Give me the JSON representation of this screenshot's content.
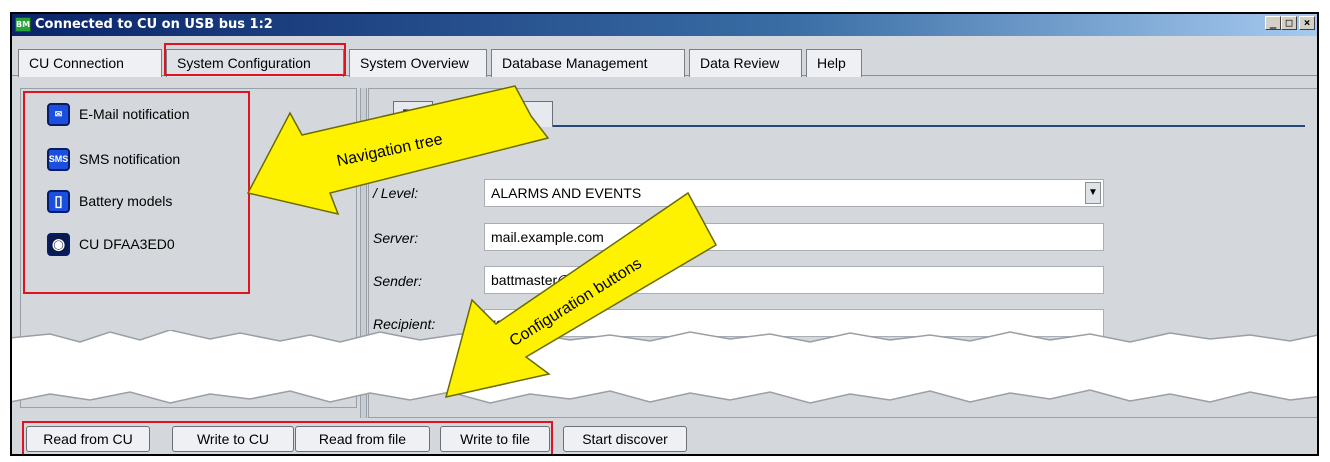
{
  "window": {
    "title": "Connected to CU on USB bus 1:2",
    "app_icon": "BM",
    "controls": [
      "_",
      "□",
      "×"
    ]
  },
  "tabs": [
    {
      "label": "CU Connection"
    },
    {
      "label": "System Configuration",
      "active": true
    },
    {
      "label": "System Overview"
    },
    {
      "label": "Database Management"
    },
    {
      "label": "Data Review"
    },
    {
      "label": "Help"
    }
  ],
  "tree": {
    "items": [
      {
        "label": "E-Mail notification",
        "icon": "envelope-icon",
        "glyph": "✉"
      },
      {
        "label": "SMS notification",
        "icon": "sms-icon",
        "glyph": "SMS"
      },
      {
        "label": "Battery models",
        "icon": "battery-icon",
        "glyph": "▯"
      },
      {
        "label": "CU DFAA3ED0",
        "icon": "cu-device-icon",
        "glyph": "◉"
      }
    ]
  },
  "panel": {
    "inner_tabs": [
      {
        "label": "E"
      },
      {
        "label": "l 2"
      }
    ],
    "fields": [
      {
        "label": "/ Level:",
        "value": "ALARMS AND EVENTS"
      },
      {
        "label": "Server:",
        "value": "mail.example.com"
      },
      {
        "label": "Sender:",
        "value": "battmaster@"
      },
      {
        "label": "Recipient:",
        "value": "reci"
      }
    ],
    "combo_arrow": "▼"
  },
  "buttons": [
    {
      "label": "Read from CU"
    },
    {
      "label": "Write to CU"
    },
    {
      "label": "Read from file"
    },
    {
      "label": "Write to file"
    },
    {
      "label": "Start discover"
    }
  ],
  "callouts": {
    "navigation": "Navigation tree",
    "configuration": "Configuration buttons"
  },
  "colors": {
    "highlight": "#e0141e",
    "arrow_fill": "#fff200",
    "titlebar": "#0a246a",
    "tree_icon": "#1a4fe0"
  }
}
